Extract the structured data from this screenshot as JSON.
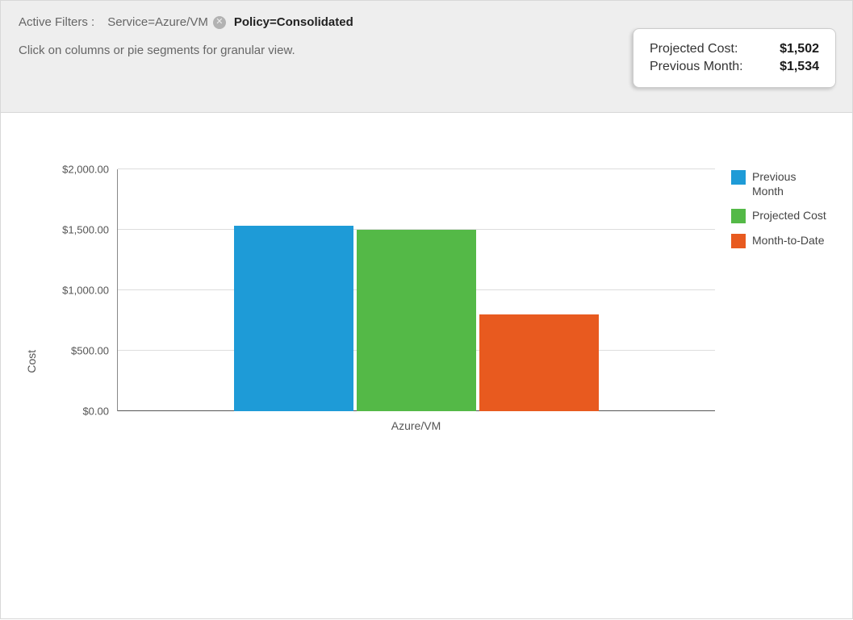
{
  "header": {
    "filters_label": "Active Filters :",
    "filter_service": "Service=Azure/VM",
    "filter_policy": "Policy=Consolidated",
    "hint": "Click on columns or pie segments for granular view."
  },
  "cost_card": {
    "projected_label": "Projected Cost:",
    "projected_value": "$1,502",
    "previous_label": "Previous Month:",
    "previous_value": "$1,534"
  },
  "chart_data": {
    "type": "bar",
    "ylabel": "Cost",
    "xlabel": "",
    "categories": [
      "Azure/VM"
    ],
    "series": [
      {
        "name": "Previous Month",
        "color": "#1e9bd7",
        "values": [
          1534
        ]
      },
      {
        "name": "Projected Cost",
        "color": "#54b947",
        "values": [
          1502
        ]
      },
      {
        "name": "Month-to-Date",
        "color": "#e85a1f",
        "values": [
          800
        ]
      }
    ],
    "ylim": [
      0,
      2000
    ],
    "y_ticks": [
      "$0.00",
      "$500.00",
      "$1,000.00",
      "$1,500.00",
      "$2,000.00"
    ]
  }
}
